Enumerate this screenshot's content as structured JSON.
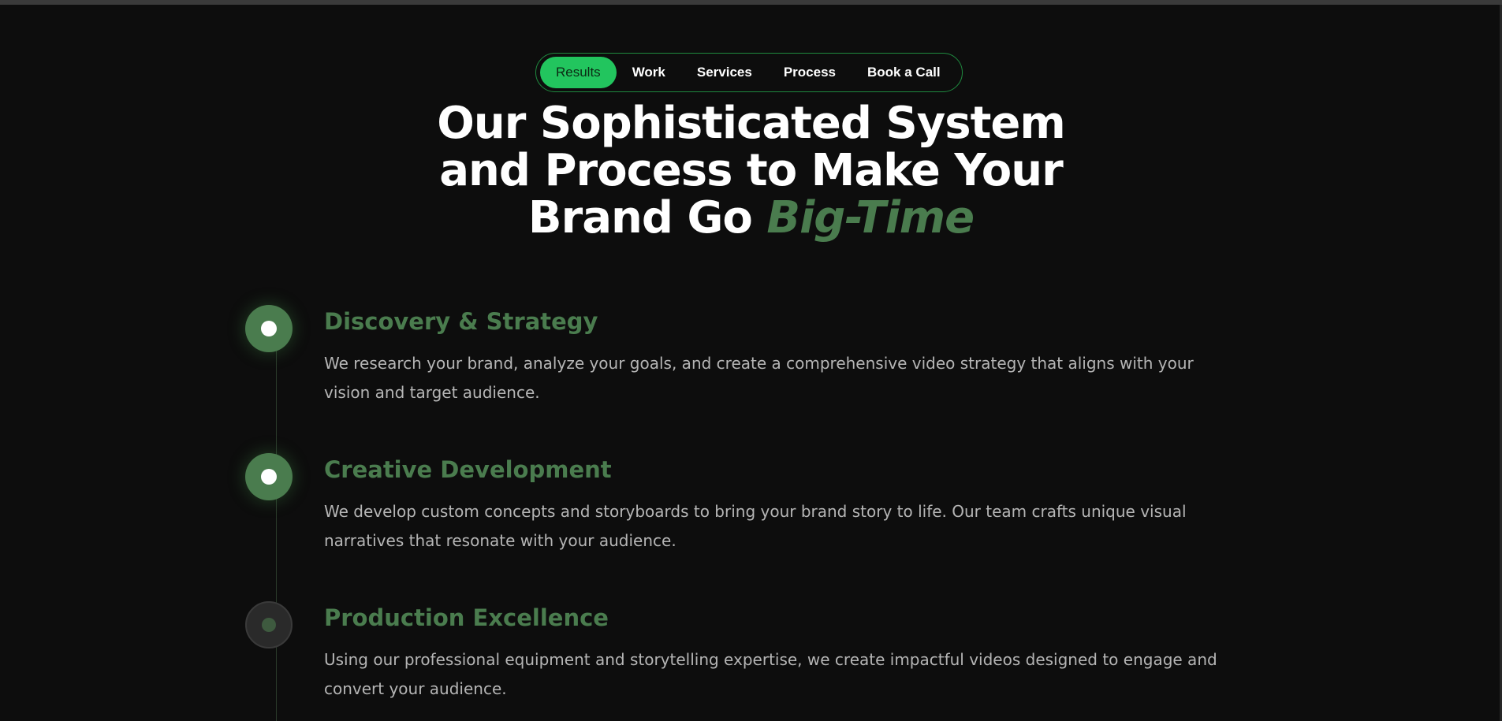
{
  "nav": {
    "items": [
      {
        "label": "Results",
        "active": true
      },
      {
        "label": "Work",
        "active": false
      },
      {
        "label": "Services",
        "active": false
      },
      {
        "label": "Process",
        "active": false
      },
      {
        "label": "Book a Call",
        "active": false
      }
    ]
  },
  "headline": {
    "line1": "Our Sophisticated System",
    "line2": "and Process to Make Your",
    "line3_prefix": "Brand Go ",
    "accent": "Big-Time"
  },
  "steps": [
    {
      "title": "Discovery & Strategy",
      "description": "We research your brand, analyze your goals, and create a comprehensive video strategy that aligns with your vision and target audience.",
      "active": true
    },
    {
      "title": "Creative Development",
      "description": "We develop custom concepts and storyboards to bring your brand story to life. Our team crafts unique visual narratives that resonate with your audience.",
      "active": true
    },
    {
      "title": "Production Excellence",
      "description": "Using our professional equipment and storytelling expertise, we create impactful videos designed to engage and convert your audience.",
      "active": false
    }
  ],
  "colors": {
    "background": "#0d0d0d",
    "accent_green": "#4a7c4e",
    "nav_active": "#22c55e",
    "nav_border": "#1f8a3f",
    "body_text": "#b5b5b5"
  }
}
